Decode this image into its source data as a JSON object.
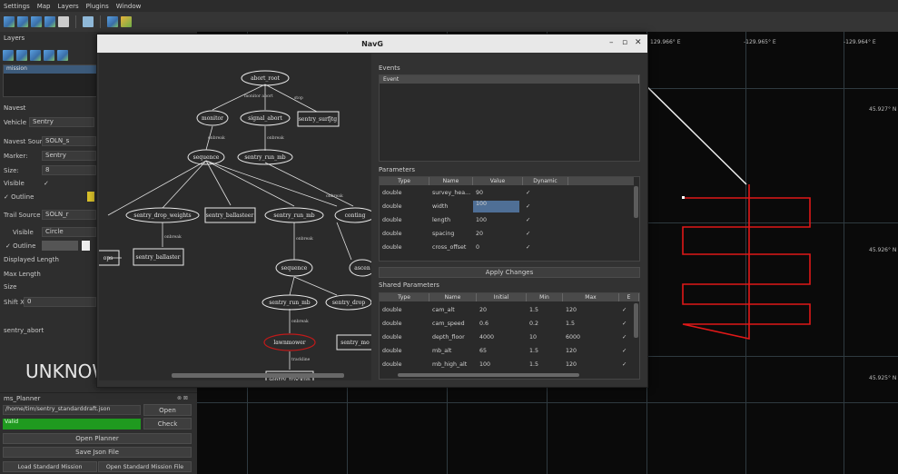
{
  "menu": [
    "Settings",
    "Map",
    "Layers",
    "Plugins",
    "Window"
  ],
  "toolbar_icons": [
    "layer-add-icon",
    "layer-add-icon",
    "layer-add-icon",
    "layer-add-icon",
    "save-icon",
    "separator",
    "map-icon",
    "separator",
    "layer-icon",
    "layer-folder-icon"
  ],
  "left": {
    "layers_title": "Layers",
    "layer_item": "mission",
    "navest_title": "Navest",
    "vehicle_label": "Vehicle",
    "vehicle_value": "Sentry",
    "rows": [
      {
        "label": "Navest Source",
        "value": "SOLN_s"
      },
      {
        "label": "Marker:",
        "value": "Sentry"
      },
      {
        "label": "Size:",
        "value": "8"
      },
      {
        "label": "Visible",
        "value": "✓"
      },
      {
        "label": "✓ Outline",
        "value": ""
      },
      {
        "label": "Trail Source",
        "value": "SOLN_r"
      },
      {
        "label": "Visible",
        "value": "Circle"
      },
      {
        "label": "✓ Outline",
        "value": ""
      },
      {
        "label": "Displayed Length",
        "value": ""
      },
      {
        "label": "Max Length",
        "value": ""
      },
      {
        "label": "Size",
        "value": ""
      },
      {
        "label": "Shift X",
        "value": "0"
      }
    ],
    "sentry_abort": "sentry_abort",
    "status": "UNKNOW",
    "planner_title": "ms_Planner",
    "planner_close": "⊗ ⊠",
    "path_value": "/home/tim/sentry_standarddraft.json",
    "open_btn": "Open",
    "green_value": "Valid",
    "check_btn": "Check",
    "open_planner_btn": "Open Planner",
    "save_json_btn": "Save Json File",
    "load_std_btn": "Load Standard Mission",
    "open_std_btn": "Open Standard Mission File"
  },
  "map": {
    "coords_top": [
      "129.966° E",
      "-129.965° E",
      "-129.964° E"
    ],
    "coords_right": [
      "45.927° N",
      "45.926° N",
      "45.925° N"
    ]
  },
  "navg": {
    "title": "NavG",
    "controls": [
      "–",
      "▫",
      "✕"
    ],
    "events_label": "Events",
    "events_header": "Event",
    "params_label": "Parameters",
    "params_headers": [
      "Type",
      "Name",
      "Value",
      "Dynamic"
    ],
    "params_rows": [
      [
        "double",
        "survey_hea...",
        "90",
        "✓"
      ],
      [
        "double",
        "width",
        "100",
        "✓"
      ],
      [
        "double",
        "length",
        "100",
        "✓"
      ],
      [
        "double",
        "spacing",
        "20",
        "✓"
      ],
      [
        "double",
        "cross_offset",
        "0",
        "✓"
      ]
    ],
    "apply_btn": "Apply Changes",
    "shared_label": "Shared Parameters",
    "shared_headers": [
      "Type",
      "Name",
      "Initial",
      "Min",
      "Max",
      "E"
    ],
    "shared_rows": [
      [
        "double",
        "cam_alt",
        "20",
        "1.5",
        "120",
        "✓"
      ],
      [
        "double",
        "cam_speed",
        "0.6",
        "0.2",
        "1.5",
        "✓"
      ],
      [
        "double",
        "depth_floor",
        "4000",
        "10",
        "6000",
        "✓"
      ],
      [
        "double",
        "mb_alt",
        "65",
        "1.5",
        "120",
        "✓"
      ],
      [
        "double",
        "mb_high_alt",
        "100",
        "1.5",
        "120",
        "✓"
      ]
    ],
    "tree_nodes": {
      "abort_root": "abort_root",
      "monitor": "monitor",
      "signal_abort": "signal_abort",
      "sentry_surfjtg": "sentry_surfjtg",
      "sequence1": "sequence",
      "sentry_run_mb1": "sentry_run_mb",
      "drop_weights": "sentry_drop_weights",
      "ballasteer1": "sentry_ballasteer",
      "sentry_run_mb2": "sentry_run_mb",
      "contingency": "conting",
      "ops": "ops",
      "ballasteer2": "sentry_ballaster",
      "sequence2": "sequence",
      "ascent": "ascen",
      "sentry_run_mb3": "sentry_run_mb",
      "sentry_drop": "sentry_drop",
      "lawnmower": "lawnmower",
      "sentry_mo": "sentry_mo",
      "sentry_tracklin": "sentry_tracklin"
    },
    "edge_labels": {
      "monitor_abort": "monitor abort",
      "stop": "stop",
      "onbreak1": "onbreak",
      "onbreak2": "onbreak",
      "onbreak3": "onbreak",
      "onbreak4": "onbreak",
      "onbreak5": "onbreak",
      "onbreak6": "onbreak",
      "trackline": "trackline"
    }
  },
  "colors": {
    "red_path": "#e01818",
    "highlight": "#c01a1a",
    "green": "#1f9a1f",
    "yellow": "#d8c02a"
  }
}
